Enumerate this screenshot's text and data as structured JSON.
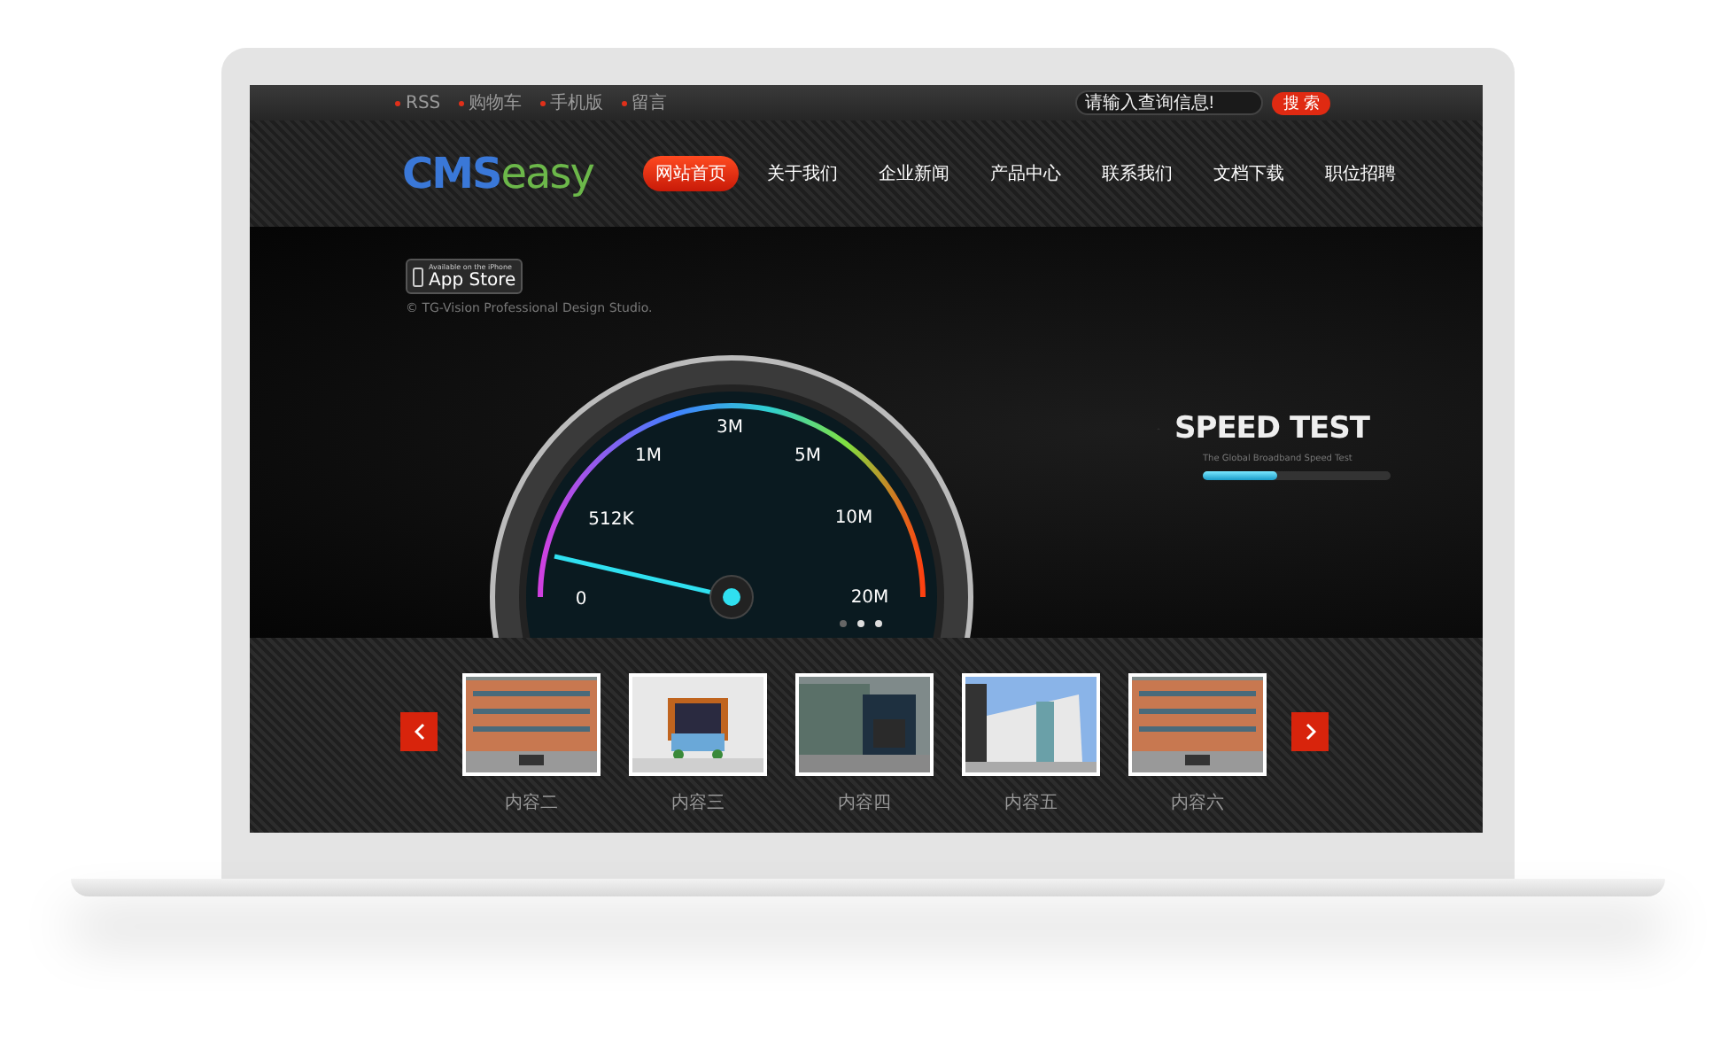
{
  "top_links": [
    "RSS",
    "购物车",
    "手机版",
    "留言"
  ],
  "search": {
    "placeholder": "请输入查询信息!",
    "button": "搜 索"
  },
  "logo": {
    "part_1": "CMS",
    "part_2": "easy"
  },
  "nav": [
    {
      "label": "网站首页",
      "selected": true
    },
    {
      "label": "关于我们",
      "selected": false
    },
    {
      "label": "企业新闻",
      "selected": false
    },
    {
      "label": "产品中心",
      "selected": false
    },
    {
      "label": "联系我们",
      "selected": false
    },
    {
      "label": "文档下载",
      "selected": false
    },
    {
      "label": "职位招聘",
      "selected": false
    }
  ],
  "banner": {
    "badge_small": "Available on the iPhone",
    "badge_large": "App Store",
    "copyright": "© TG-Vision Professional Design Studio.",
    "gauge_labels": [
      "0",
      "512K",
      "1M",
      "3M",
      "5M",
      "10M",
      "20M"
    ],
    "title": "SPEED TEST",
    "subtitle": "The Global Broadband Speed Test",
    "progress": {
      "level": 0.4
    }
  },
  "slide_dots": [
    {
      "selected": false
    },
    {
      "selected": true
    },
    {
      "selected": true
    }
  ],
  "thumbnails": [
    {
      "caption": "内容二",
      "kind": "picture"
    },
    {
      "caption": "内容三",
      "kind": "picture"
    },
    {
      "caption": "内容四",
      "kind": "picture"
    },
    {
      "caption": "内容五",
      "kind": "picture"
    },
    {
      "caption": "内容六",
      "kind": "picture"
    }
  ]
}
